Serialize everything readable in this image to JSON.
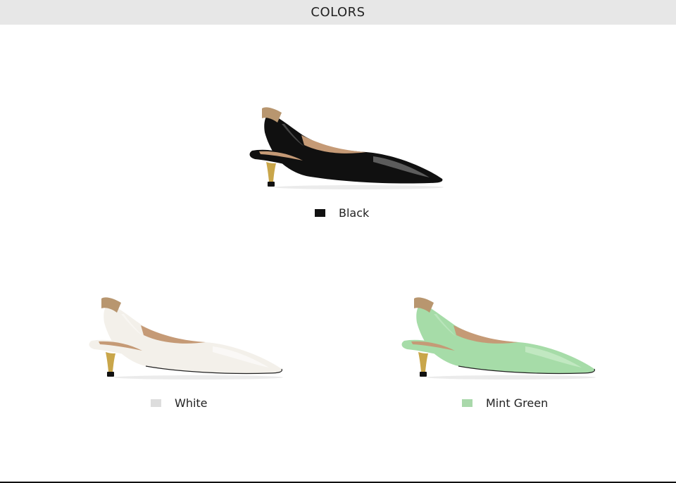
{
  "header": {
    "title": "COLORS"
  },
  "colors": {
    "header_bg": "#e7e7e7",
    "elastic_strap": "#b8966f",
    "gold_heel": "#c9a64a",
    "heel_tip": "#111111",
    "lining": "#c59a76"
  },
  "products": [
    {
      "name": "Black",
      "swatch_color": "#111111",
      "shoe_color": "#101010",
      "shoe_highlight": "#9a9a9a",
      "icon": "slingback-shoe-icon"
    },
    {
      "name": "White",
      "swatch_color": "#dddddd",
      "shoe_color": "#f3f0ea",
      "shoe_highlight": "#ffffff",
      "icon": "slingback-shoe-icon"
    },
    {
      "name": "Mint Green",
      "swatch_color": "#a9d8aa",
      "shoe_color": "#a6dca8",
      "shoe_highlight": "#d7f2d6",
      "icon": "slingback-shoe-icon"
    }
  ]
}
